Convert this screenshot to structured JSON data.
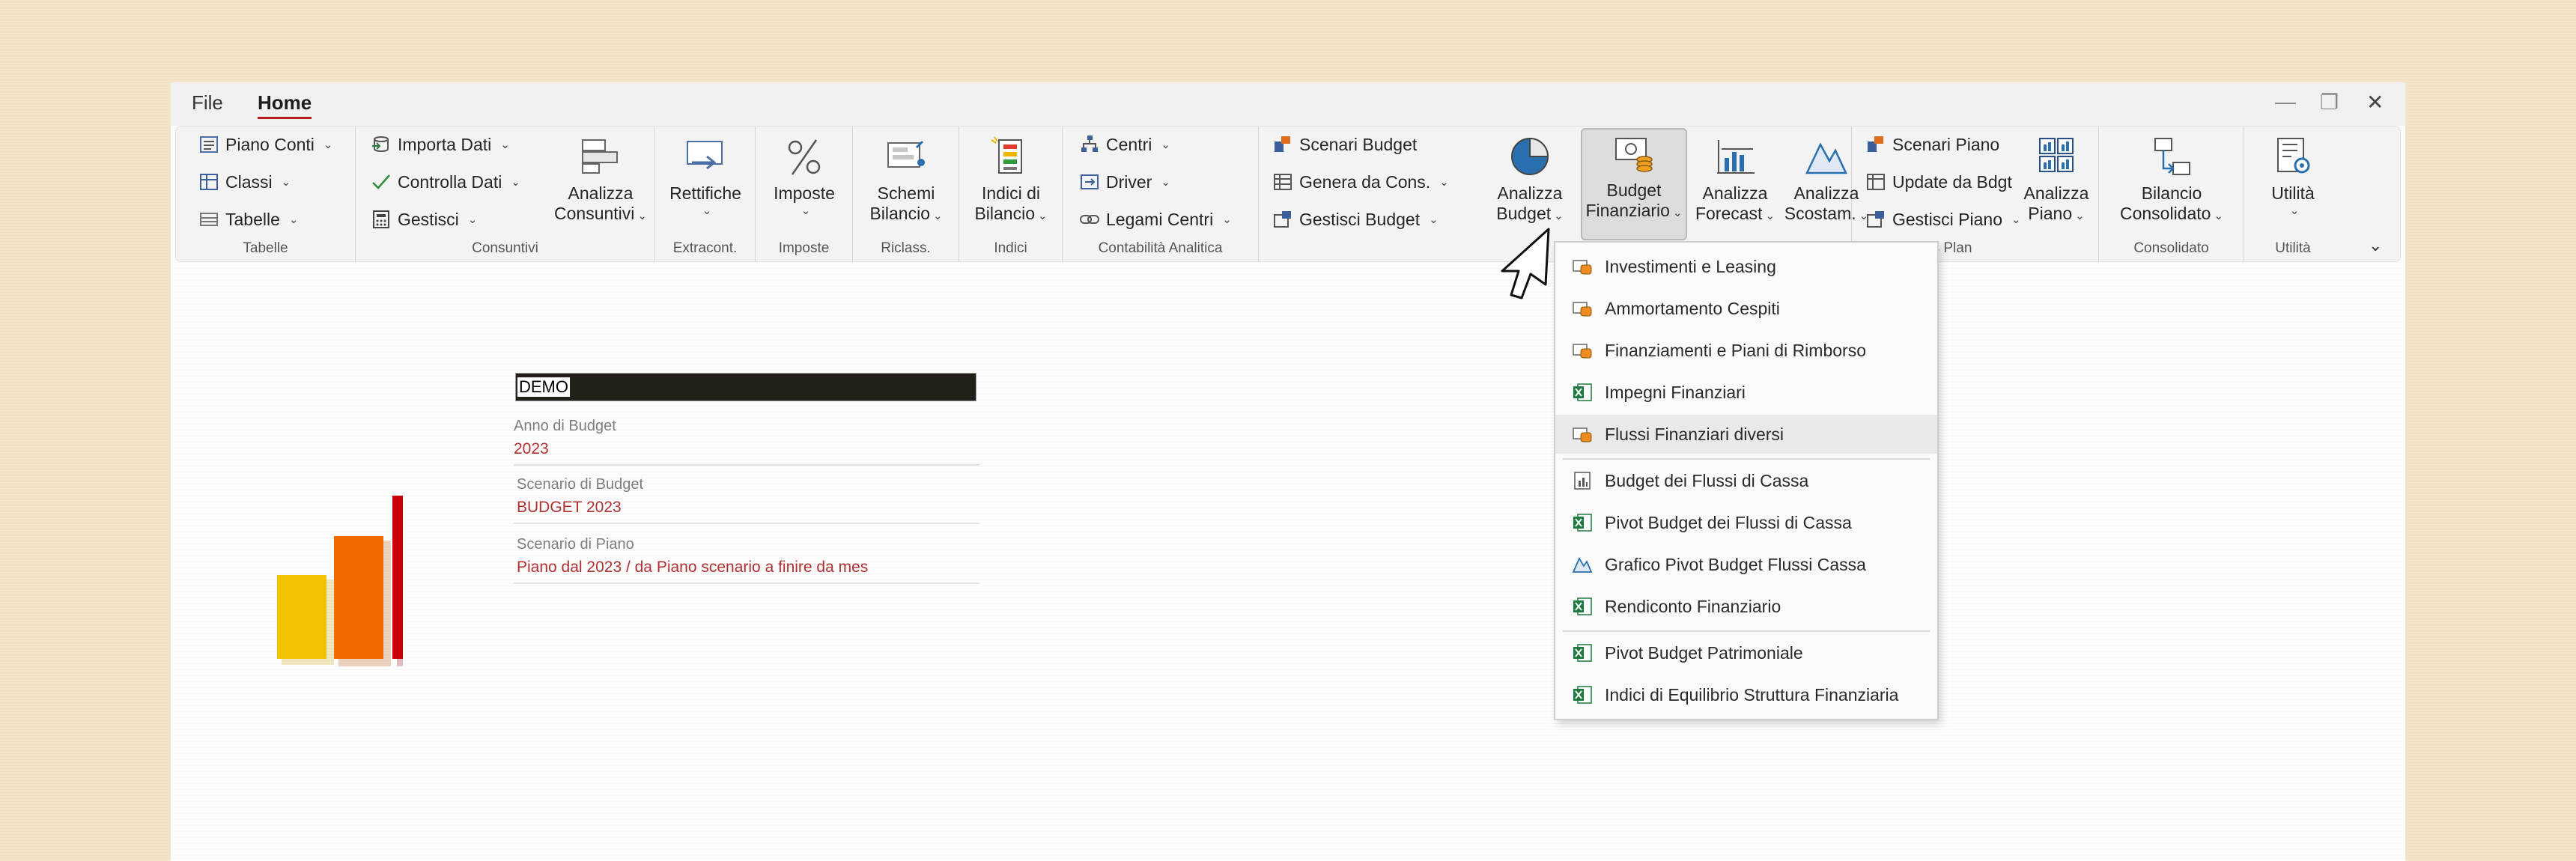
{
  "menu": {
    "file": "File",
    "home": "Home"
  },
  "window_controls": {
    "minimize": "—",
    "restore": "❐",
    "close": "✕"
  },
  "ribbon": {
    "tabelle": {
      "label": "Tabelle",
      "piano_conti": "Piano Conti",
      "classi": "Classi",
      "tabelle": "Tabelle"
    },
    "consuntivi": {
      "label": "Consuntivi",
      "importa_dati": "Importa Dati",
      "controlla_dati": "Controlla Dati",
      "gestisci": "Gestisci",
      "analizza_1": "Analizza",
      "analizza_2": "Consuntivi"
    },
    "extracont": {
      "label": "Extracont.",
      "rettifiche": "Rettifiche"
    },
    "imposte": {
      "label": "Imposte",
      "imposte": "Imposte"
    },
    "riclass": {
      "label": "Riclass.",
      "line1": "Schemi",
      "line2": "Bilancio"
    },
    "indici": {
      "label": "Indici",
      "line1": "Indici di",
      "line2": "Bilancio"
    },
    "contabilita": {
      "label": "Contabilità Analitica",
      "centri": "Centri",
      "driver": "Driver",
      "legami": "Legami Centri"
    },
    "budget": {
      "scenari": "Scenari Budget",
      "genera": "Genera da Cons.",
      "gestisci": "Gestisci Budget",
      "analizza_1": "Analizza",
      "analizza_2": "Budget",
      "fin_1": "Budget",
      "fin_2": "Finanziario",
      "forecast_1": "Analizza",
      "forecast_2": "Forecast",
      "scostam_1": "Analizza",
      "scostam_2": "Scostam."
    },
    "business_plan": {
      "label": "Business Plan",
      "scenari": "Scenari Piano",
      "update": "Update da Bdgt",
      "gestisci": "Gestisci Piano",
      "analizza_1": "Analizza",
      "analizza_2": "Piano"
    },
    "consolidato": {
      "label": "Consolidato",
      "line1": "Bilancio",
      "line2": "Consolidato"
    },
    "utilita": {
      "label": "Utilità",
      "line1": "Utilità"
    }
  },
  "dropdown": {
    "items": [
      "Investimenti e Leasing",
      "Ammortamento Cespiti",
      "Finanziamenti e Piani di Rimborso",
      "Impegni Finanziari",
      "Flussi Finanziari diversi",
      "Budget dei Flussi di Cassa",
      "Pivot Budget dei Flussi di Cassa",
      "Grafico Pivot Budget Flussi Cassa",
      "Rendiconto Finanziario",
      "Pivot Budget Patrimoniale",
      "Indici di Equilibrio Struttura Finanziaria"
    ]
  },
  "info": {
    "company": "DEMO",
    "anno_label": "Anno di Budget",
    "anno_value": "2023",
    "scenario_label": "Scenario di Budget",
    "scenario_value": "BUDGET 2023",
    "piano_label": "Scenario di Piano",
    "piano_value": "Piano dal 2023 / da Piano scenario a finire da mes"
  },
  "colors": {
    "accent": "#b31c1c",
    "bar_yellow": "#f2c200",
    "bar_orange": "#f06a00",
    "bar_red": "#c8000a",
    "excel_green": "#1d7a3e"
  }
}
